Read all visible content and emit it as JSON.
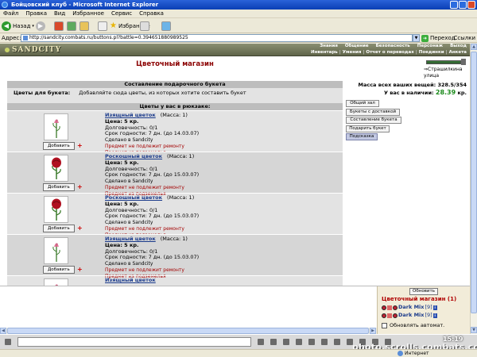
{
  "window": {
    "title": "Бойцовский клуб - Microsoft Internet Explorer"
  },
  "menu": [
    "Файл",
    "Правка",
    "Вид",
    "Избранное",
    "Сервис",
    "Справка"
  ],
  "toolbar": {
    "back": "Назад",
    "favorites": "Избранное"
  },
  "address": {
    "label": "Адрес:",
    "url": "http://sandcity.combats.ru/buttons.pl?battle=0.394651880989525",
    "go": "Переход",
    "links": "Ссылки"
  },
  "game": {
    "logo": "SANDCITY",
    "nav_top": [
      "Знания",
      "Общение",
      "Безопасность",
      "Персонаж",
      "Выход"
    ],
    "nav_sub": [
      "Инвентарь",
      "Умения",
      "Отчет о переводах",
      "Поединки",
      "Анкета"
    ]
  },
  "shop": {
    "title": "Цветочный магазин",
    "street_link": "Страшилкина улица",
    "bouquet_header": "Составление подарочного букета",
    "flowers_label": "Цветы для букета:",
    "flowers_hint": "Добавляйте сюда цветы, из которых хотите составить букет",
    "backpack_header": "Цветы у вас в рюкзаке:",
    "add_label": "Добавить",
    "items": [
      {
        "name": "Изящный цветок",
        "mass": "(Масса: 1)",
        "price": "Цена: 5 кр.",
        "durability": "Долговечность: 0/1",
        "expiry": "Срок годности: 7 дн. (до 14.03.07)",
        "maker": "Сделано в Sandcity",
        "note1": "Предмет не подлежит ремонту",
        "note2": "Предмет из подземелья",
        "kind": "elegant"
      },
      {
        "name": "Роскошный цветок",
        "mass": "(Масса: 1)",
        "price": "Цена: 5 кр.",
        "durability": "Долговечность: 0/1",
        "expiry": "Срок годности: 7 дн. (до 15.03.07)",
        "maker": "Сделано в Sandcity",
        "note1": "Предмет не подлежит ремонту",
        "note2": "Предмет из подземелья",
        "kind": "rose"
      },
      {
        "name": "Роскошный цветок",
        "mass": "(Масса: 1)",
        "price": "Цена: 5 кр.",
        "durability": "Долговечность: 0/1",
        "expiry": "Срок годности: 7 дн. (до 15.03.07)",
        "maker": "Сделано в Sandcity",
        "note1": "Предмет не подлежит ремонту",
        "note2": "Предмет из подземелья",
        "kind": "rose"
      },
      {
        "name": "Изящный цветок",
        "mass": "(Масса: 1)",
        "price": "Цена: 5 кр.",
        "durability": "Долговечность: 0/1",
        "expiry": "Срок годности: 7 дн. (до 15.03.07)",
        "maker": "Сделано в Sandcity",
        "note1": "Предмет не подлежит ремонту",
        "note2": "Предмет из подземелья",
        "kind": "elegant"
      },
      {
        "name": "Изящный цветок",
        "mass": "",
        "price": "",
        "durability": "",
        "expiry": "",
        "maker": "",
        "note1": "",
        "note2": "",
        "kind": "elegant"
      }
    ]
  },
  "side": {
    "mass_label": "Масса всех ваших вещей: 328.5/354",
    "money_label": "У вас в наличии:",
    "money_value": "28.39",
    "money_unit": "кр.",
    "buttons": [
      "Общий зал",
      "Букеты с доставкой",
      "Составление букета",
      "Подарить букет",
      "Подсказка"
    ]
  },
  "chat": {
    "refresh": "Обновить",
    "title": "Цветочный магазин (1)",
    "users": [
      {
        "name": "Dark Mix",
        "level": "[9]"
      },
      {
        "name": "Dark Mix",
        "level": "[9]"
      }
    ],
    "auto_refresh": "Обновлять автомат."
  },
  "clock": "15:19",
  "watermark": "photo.scrolls.combats.com",
  "status": {
    "zone": "Интернет"
  },
  "colors": {
    "title_red": "#8b0000",
    "money_green": "#1b8a1b",
    "link_blue": "#1a3a8b"
  }
}
